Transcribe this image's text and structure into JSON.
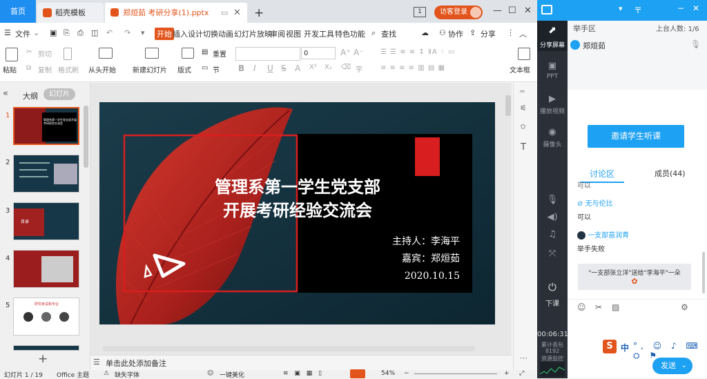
{
  "tabs": {
    "home": "首页",
    "templates": "稻壳模板",
    "document": "郑烜茹 考研分享(1).pptx",
    "badge": "1",
    "login": "访客登录"
  },
  "menu": {
    "file": "文件",
    "start": "开始",
    "insert": "插入",
    "design": "设计",
    "switch": "切换",
    "animation": "动画",
    "slideshow": "幻灯片放映",
    "review": "审阅",
    "view": "视图",
    "devtools": "开发工具",
    "features": "特色功能",
    "search": "查找",
    "collab": "协作",
    "share": "分享"
  },
  "ribbon": {
    "paste": "粘贴",
    "cut": "剪切",
    "copy": "复制",
    "format_painter": "格式刷",
    "from_start": "从头开始",
    "new_slide": "新建幻灯片",
    "layout": "版式",
    "section": "节",
    "reset": "重置",
    "font_size": "0",
    "textbox": "文本框"
  },
  "left": {
    "outline": "大纲",
    "slides": "幻灯片",
    "nums": [
      "1",
      "2",
      "3",
      "4",
      "5"
    ],
    "add": "+"
  },
  "slide": {
    "title_line1": "管理系第一学生党支部",
    "title_line2": "开展考研经验交流会",
    "host": "主持人：李海平",
    "guest": "嘉宾：郑烜茹",
    "date": "2020.10.15"
  },
  "thumbnails": {
    "t1_title": "管理系第一学生党支部开展考研经验交流会",
    "t3_label": "目录",
    "t5_label": "研究考试和专业"
  },
  "notes": "单击此处添加备注",
  "status": {
    "page": "幻灯片 1 / 19",
    "theme": "Office 主题",
    "font_missing": "缺失字体",
    "beautify": "一键美化",
    "zoom": "54%"
  },
  "classroom": {
    "share_screen": "分享屏幕",
    "ppt": "PPT",
    "play_video": "播放视频",
    "camera": "摄像头",
    "hands_up": "举手区",
    "on_stage": "上台人数: 1/6",
    "hand_user": "郑烜茹",
    "invite": "邀请学生听课",
    "tab_discussion": "讨论区",
    "tab_members": "成员(44)",
    "msg0": "可以",
    "user1": "无与伦比",
    "msg1": "可以",
    "user2": "一支部苗润青",
    "msg2": "举手失败",
    "gift": "\"一支部张立洋\"送给\"李海平\"一朵",
    "end_class": "下课",
    "timer": "00:06:31",
    "lost_packets_label": "累计丢包",
    "lost_packets": "8192",
    "resource_monitor": "资源监控",
    "ime_lang": "中",
    "send": "发送"
  },
  "colors": {
    "wps_accent": "#e2541b",
    "classroom_blue": "#1da1f2",
    "slide_red": "#d81e1e"
  }
}
